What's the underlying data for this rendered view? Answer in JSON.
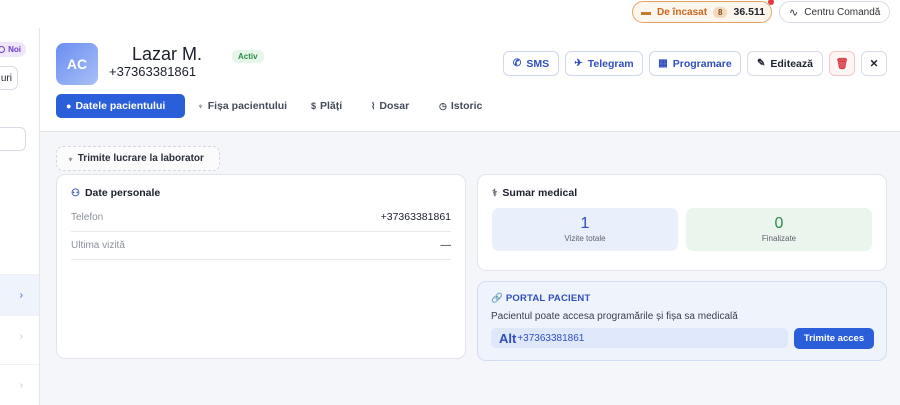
{
  "topbar": {
    "cash_label": "De încasat",
    "cash_count": "8",
    "cash_value": "36.511",
    "command_label": "Centru Comandă"
  },
  "sidebar": {
    "badge_label": "Noi",
    "button_label": "uri",
    "chevron": "›"
  },
  "patient": {
    "initials": "AC",
    "name": "Lazar M.",
    "phone": "+37363381861",
    "status": "Activ"
  },
  "actions": {
    "sms": "SMS",
    "telegram": "Telegram",
    "appointment": "Programare",
    "edit": "Editează"
  },
  "tabs": [
    {
      "label": "Datele pacientului"
    },
    {
      "label": "Fișa pacientului"
    },
    {
      "label": "Plăți"
    },
    {
      "label": "Dosar"
    },
    {
      "label": "Istoric"
    }
  ],
  "lab": {
    "label": "Trimite lucrare la laborator"
  },
  "personal": {
    "title": "Date personale",
    "rows": [
      {
        "key": "Telefon",
        "value": "+37363381861"
      },
      {
        "key": "Ultima vizită",
        "value": "—"
      }
    ]
  },
  "medical": {
    "title": "Sumar medical",
    "total_visits": "1",
    "total_visits_label": "Vizite totale",
    "finished": "0",
    "finished_label": "Finalizate"
  },
  "portal": {
    "title": "PORTAL PACIENT",
    "description": "Pacientul poate accesa programările și fișa sa medicală",
    "field_prefix": "Alt",
    "field_value": "+37363381861",
    "send_label": "Trimite acces"
  },
  "colors": {
    "accent": "#2b5fd9",
    "success": "#2e8b48",
    "danger": "#d9363e",
    "warning": "#c9651d"
  }
}
